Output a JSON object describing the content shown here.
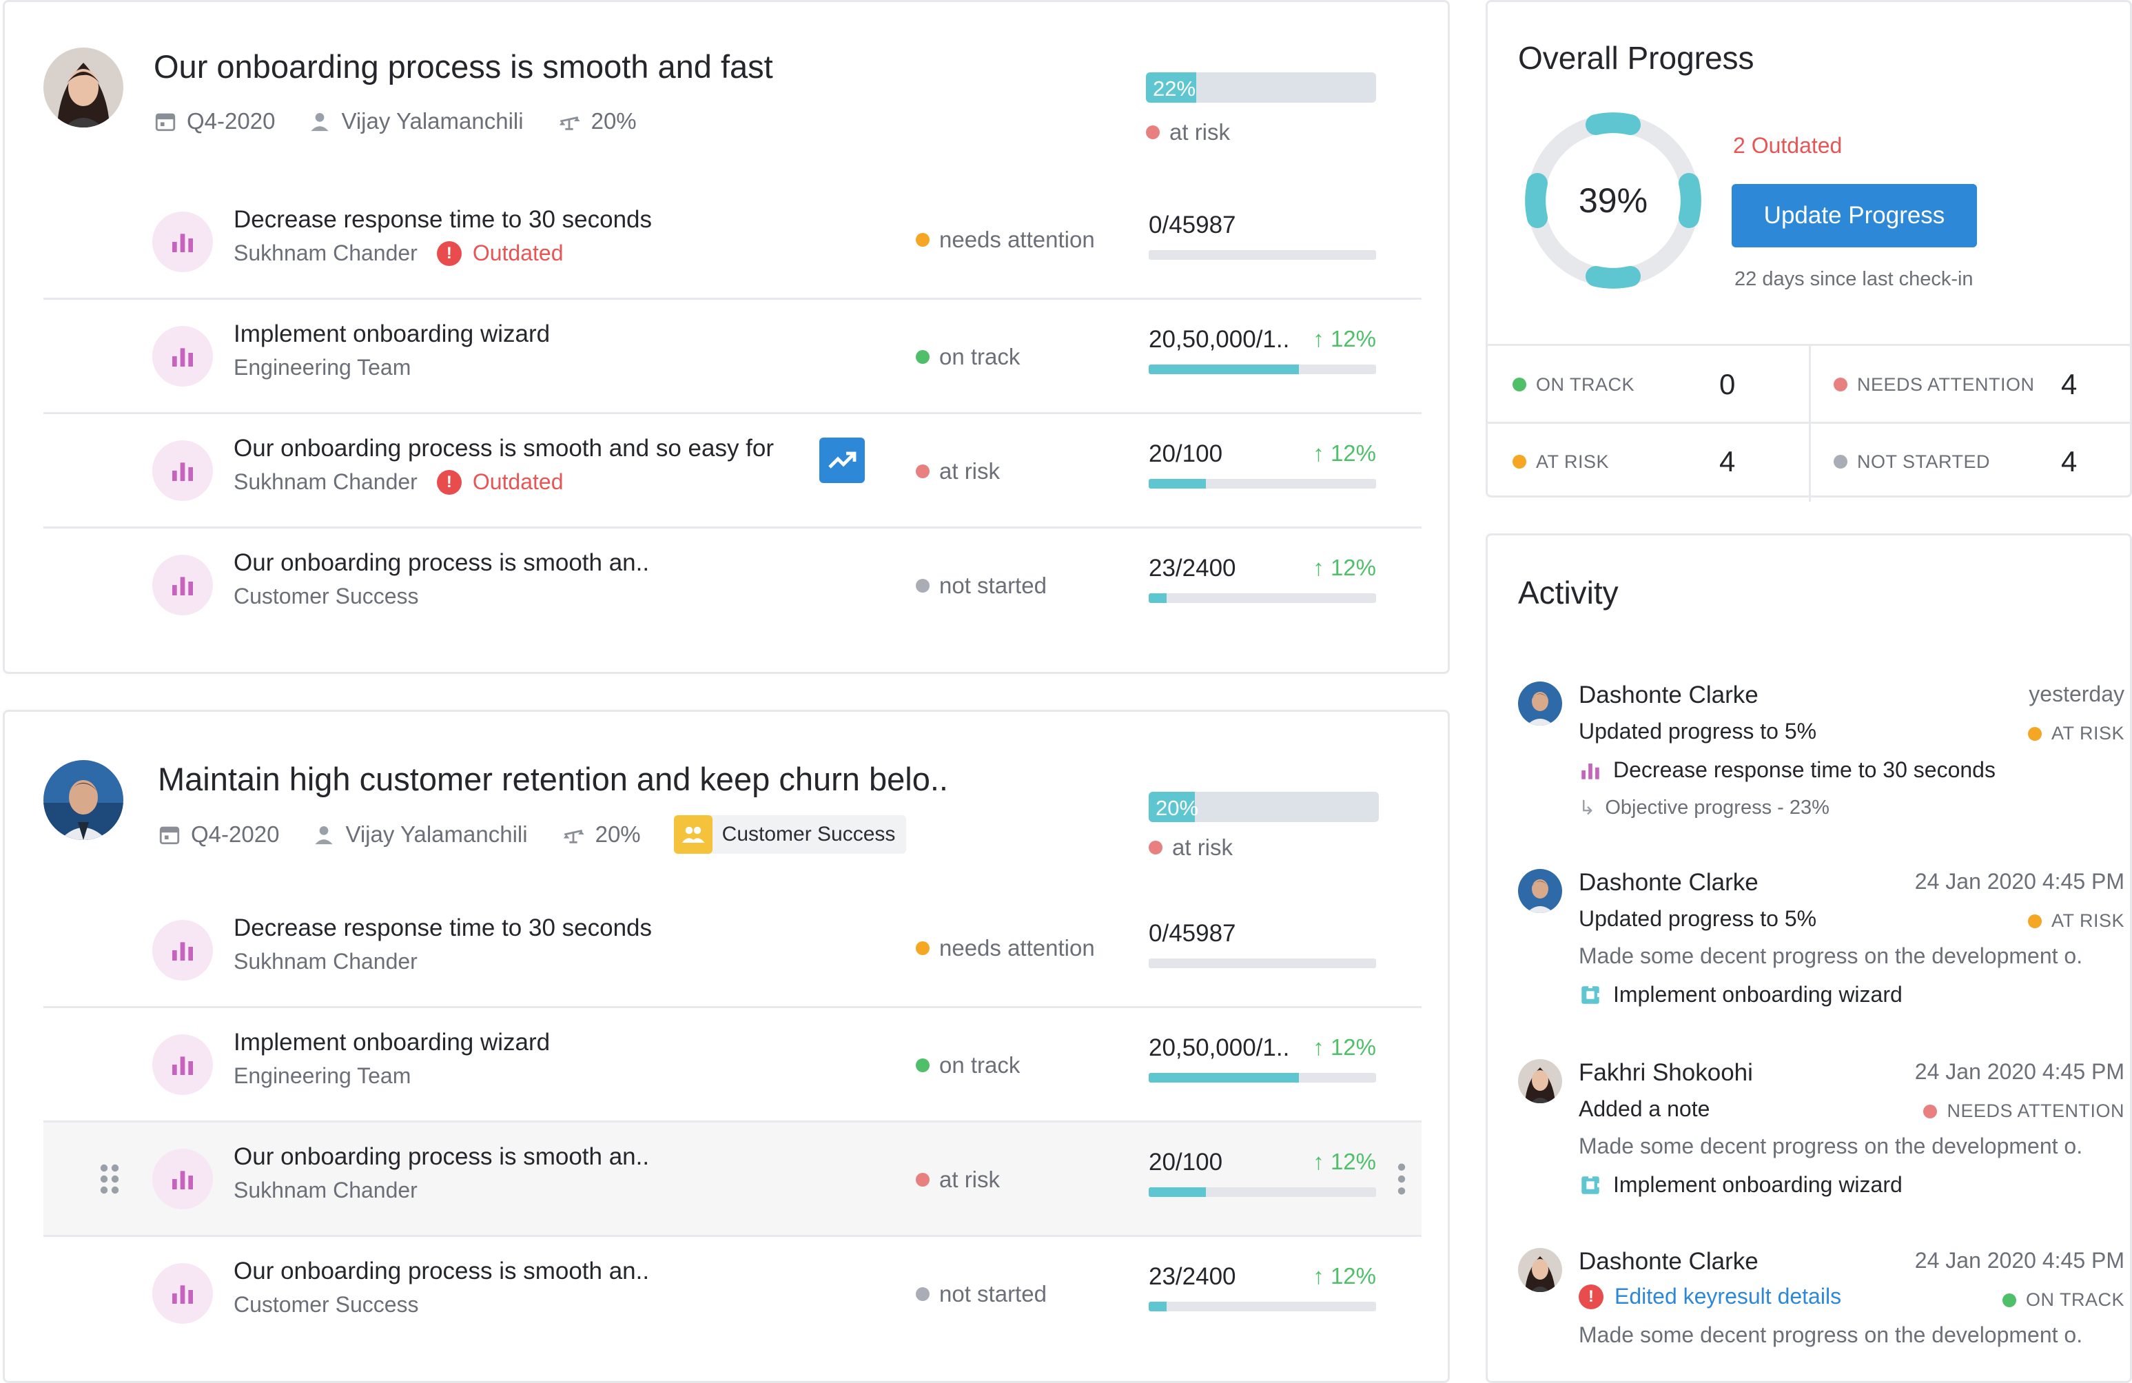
{
  "colors": {
    "teal": "#5ec6d1",
    "blue": "#2e88d8",
    "red": "#e85555",
    "green": "#4fbf6a",
    "amber": "#f5a623",
    "salmon": "#e88080",
    "gray": "#a9adb6",
    "purple": "#c663bd"
  },
  "objectives": [
    {
      "title": "Our onboarding process is smooth and fast",
      "quarter": "Q4-2020",
      "owner": "Vijay Yalamanchili",
      "weight": "20%",
      "team": "",
      "progress_label": "22%",
      "progress": 22,
      "status": "at risk",
      "key_results": [
        {
          "title": "Decrease response time to 30 seconds",
          "owner": "Sukhnam Chander",
          "outdated": "Outdated",
          "status": "needs attention",
          "value": "0/45987",
          "delta": "",
          "progress": 0
        },
        {
          "title": "Implement onboarding wizard",
          "owner": "Engineering Team",
          "outdated": "",
          "status": "on track",
          "value": "20,50,000/1..",
          "delta": "↑ 12%",
          "progress": 66
        },
        {
          "title": "Our onboarding process is smooth and so easy for",
          "owner": "Sukhnam Chander",
          "outdated": "Outdated",
          "status": "at risk",
          "value": "20/100",
          "delta": "↑ 12%",
          "progress": 25
        },
        {
          "title": "Our onboarding process is smooth an..",
          "owner": "Customer Success",
          "outdated": "",
          "status": "not started",
          "value": "23/2400",
          "delta": "↑ 12%",
          "progress": 8
        }
      ]
    },
    {
      "title": "Maintain high customer retention and keep churn belo..",
      "quarter": "Q4-2020",
      "owner": "Vijay Yalamanchili",
      "weight": "20%",
      "team": "Customer Success",
      "progress_label": "20%",
      "progress": 20,
      "status": "at risk",
      "key_results": [
        {
          "title": "Decrease response time to 30 seconds",
          "owner": "Sukhnam Chander",
          "outdated": "",
          "status": "needs attention",
          "value": "0/45987",
          "delta": "",
          "progress": 0
        },
        {
          "title": "Implement onboarding wizard",
          "owner": "Engineering Team",
          "outdated": "",
          "status": "on track",
          "value": "20,50,000/1..",
          "delta": "↑ 12%",
          "progress": 66
        },
        {
          "title": "Our onboarding process is smooth an..",
          "owner": "Sukhnam Chander",
          "outdated": "",
          "status": "at risk",
          "value": "20/100",
          "delta": "↑ 12%",
          "progress": 25
        },
        {
          "title": "Our onboarding process is smooth an..",
          "owner": "Customer Success",
          "outdated": "",
          "status": "not started",
          "value": "23/2400",
          "delta": "↑ 12%",
          "progress": 8
        }
      ]
    }
  ],
  "overall": {
    "title": "Overall Progress",
    "percent_label": "39%",
    "outdated": "2 Outdated",
    "button": "Update Progress",
    "since": "22 days since last check-in",
    "counts": [
      {
        "label": "ON TRACK",
        "value": "0"
      },
      {
        "label": "NEEDS ATTENTION",
        "value": "4"
      },
      {
        "label": "AT RISK",
        "value": "4"
      },
      {
        "label": "NOT STARTED",
        "value": "4"
      }
    ]
  },
  "activity": {
    "title": "Activity",
    "items": [
      {
        "name": "Dashonte Clarke",
        "time": "yesterday",
        "action": "Updated progress to 5%",
        "status": "AT RISK",
        "kr": "Decrease response time to 30 seconds",
        "objective": "Objective progress - 23%"
      },
      {
        "name": "Dashonte Clarke",
        "time": "24 Jan 2020 4:45 PM",
        "action": "Updated progress to 5%",
        "status": "AT RISK",
        "desc": "Made some decent progress on the development o.",
        "kr": "Implement onboarding wizard"
      },
      {
        "name": "Fakhri Shokoohi",
        "time": "24 Jan 2020 4:45 PM",
        "action": "Added a note",
        "status": "NEEDS ATTENTION",
        "desc": "Made some decent progress on the development o.",
        "kr": "Implement onboarding wizard"
      },
      {
        "name": "Dashonte Clarke",
        "time": "24 Jan 2020 4:45 PM",
        "action": "Edited keyresult details",
        "status": "ON TRACK",
        "desc": "Made some decent progress on the development o."
      }
    ]
  }
}
